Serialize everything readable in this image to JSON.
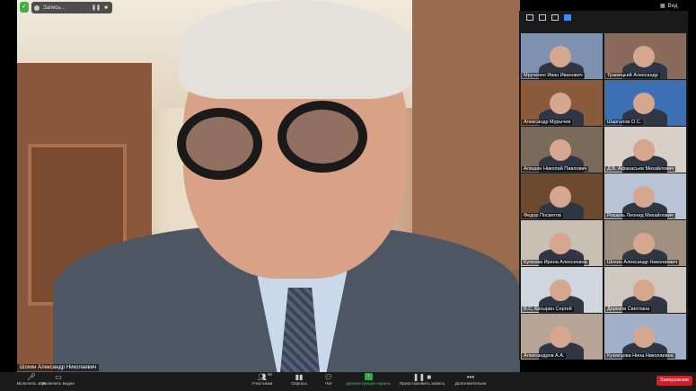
{
  "recording": {
    "label": "Запись...",
    "pause": "❚❚",
    "stop": "■"
  },
  "security_icon": "shield-icon",
  "view": {
    "label": "Вид",
    "icon": "grid-icon"
  },
  "main_speaker": {
    "name": "Шохин Александр Николаевич"
  },
  "participants": [
    {
      "name": "Мрученко Иван Иванович",
      "bg": "#7d91b0"
    },
    {
      "name": "Трамецкий Александр",
      "bg": "#8a6a5a"
    },
    {
      "name": "Александр Мурычев",
      "bg": "#8b5a3a"
    },
    {
      "name": "Шаргалов О.С.",
      "bg": "#3d6fb5"
    },
    {
      "name": "Алешин Николай Павлович",
      "bg": "#7a6a5a"
    },
    {
      "name": "Д.В. Афанасьев Михайлович",
      "bg": "#d8d0c8"
    },
    {
      "name": "Федор Посветов",
      "bg": "#6d4a2f"
    },
    {
      "name": "Рошаль Леонид Михайлович",
      "bg": "#b8c4d6"
    },
    {
      "name": "Кулеева Ирена Алексеевна",
      "bg": "#c9bfb3"
    },
    {
      "name": "Шохин Александр Николаевич",
      "bg": "#a09080"
    },
    {
      "name": "В.С. Катырин Сергей",
      "bg": "#cfd6dd"
    },
    {
      "name": "Дерезов Светлана",
      "bg": "#cfc8c0"
    },
    {
      "name": "Александров А.А.",
      "bg": "#b6a594"
    },
    {
      "name": "Кузнецова Нина Николаевна",
      "bg": "#9fb0c8"
    }
  ],
  "toolbar": {
    "mic_label": "Включить звук",
    "video_label": "Включить видео",
    "participants_label": "Участники",
    "participants_count": "66",
    "polls_label": "Опросы",
    "chat_label": "Чат",
    "share_label": "Демонстрация экрана",
    "pause_recording_label": "Приостановить запись",
    "more_label": "Дополнительно",
    "end_label": "Завершение"
  }
}
